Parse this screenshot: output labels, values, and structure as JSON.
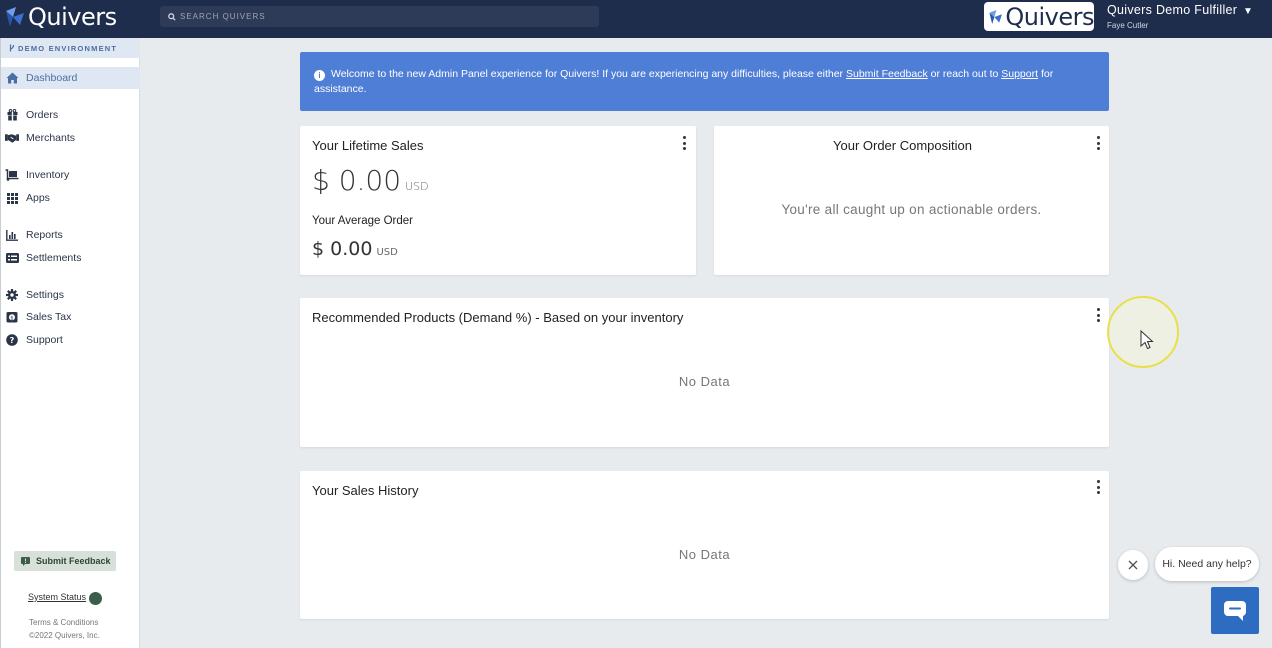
{
  "topbar": {
    "logo_text": "Quivers",
    "search_placeholder": "SEARCH QUIVERS",
    "brand_box_text": "Quivers",
    "user_name": "Quivers Demo Fulfiller",
    "user_sub": "Faye Cutler"
  },
  "sidebar": {
    "env_label": "DEMO ENVIRONMENT",
    "items": [
      {
        "label": "Dashboard",
        "icon": "home-icon"
      },
      {
        "label": "Orders",
        "icon": "gift-icon"
      },
      {
        "label": "Merchants",
        "icon": "handshake-icon"
      },
      {
        "label": "Inventory",
        "icon": "dolly-icon"
      },
      {
        "label": "Apps",
        "icon": "grid-icon"
      },
      {
        "label": "Reports",
        "icon": "bar-chart-icon"
      },
      {
        "label": "Settlements",
        "icon": "receipt-icon"
      },
      {
        "label": "Settings",
        "icon": "gear-icon"
      },
      {
        "label": "Sales Tax",
        "icon": "money-bag-icon"
      },
      {
        "label": "Support",
        "icon": "question-circle-icon"
      }
    ],
    "feedback_label": "Submit Feedback",
    "status_label": "System Status",
    "status_color": "#3b5e48",
    "terms": "Terms & Conditions",
    "copyright": "©2022 Quivers, Inc."
  },
  "banner": {
    "text_before": "Welcome to the new Admin Panel experience for Quivers! If you are experiencing any difficulties, please either ",
    "feedback_link": "Submit Feedback",
    "text_middle": " or reach out to ",
    "support_link": "Support",
    "text_after": " for assistance.",
    "color": "#4f7ed6"
  },
  "lifetime": {
    "title": "Your Lifetime Sales",
    "amount": "$ 0.00",
    "currency": "USD",
    "avg_title": "Your Average Order",
    "avg_amount": "$ 0.00",
    "avg_currency": "USD"
  },
  "composition": {
    "title": "Your Order Composition",
    "empty_text": "You're all caught up on actionable orders."
  },
  "recommended": {
    "title": "Recommended Products (Demand %) - Based on your inventory",
    "empty_text": "No Data"
  },
  "history": {
    "title": "Your Sales History",
    "empty_text": "No Data"
  },
  "chat": {
    "bubble_text": "Hi. Need any help?"
  }
}
